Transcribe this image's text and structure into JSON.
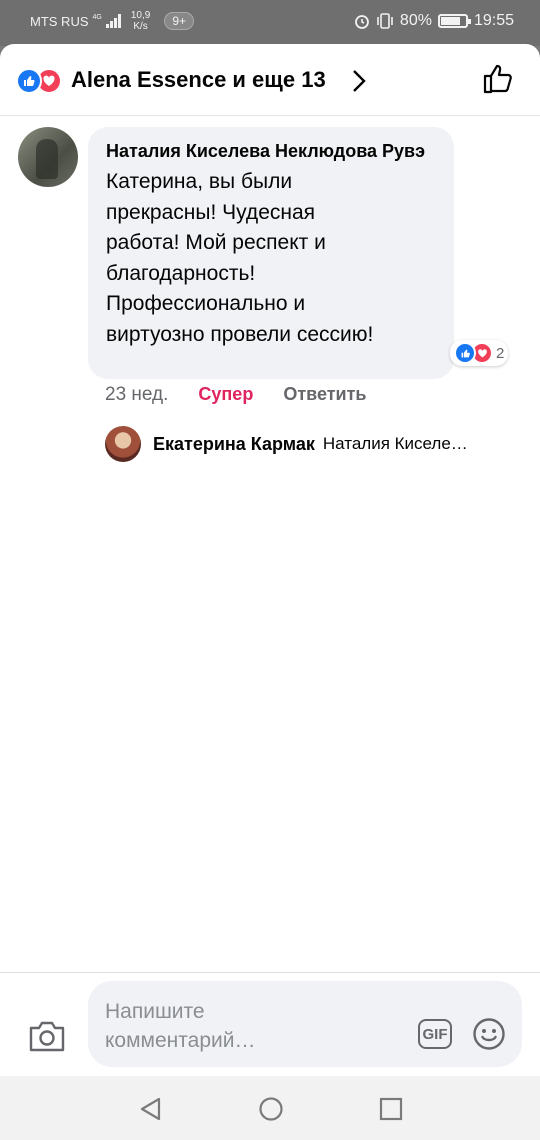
{
  "status_bar": {
    "carrier": "MTS RUS",
    "network": "4G",
    "speed_value": "10,9",
    "speed_unit": "K/s",
    "notifications": "9+",
    "battery_percent": "80%",
    "time": "19:55"
  },
  "header": {
    "title": "Alena Essence и еще 13",
    "reaction_icons": [
      "like-icon",
      "love-icon"
    ]
  },
  "comment": {
    "author": "Наталия Киселева Неклюдова Рувэ",
    "text": "Катерина, вы были\nпрекрасны! Чудесная\nработа! Мой респект и\nблагодарность!\nПрофессионально и\nвиртуозно провели сессию!",
    "reaction_count": "2",
    "time_ago": "23 нед.",
    "reaction_label": "Супер",
    "reply_label": "Ответить"
  },
  "reply": {
    "author": "Екатерина Кармак",
    "preview": "Наталия Киселе…"
  },
  "composer": {
    "placeholder": "Напишите\nкомментарий…",
    "gif_label": "GIF"
  },
  "colors": {
    "like_blue": "#1877f2",
    "love_red": "#f33e58",
    "super_pink": "#e0245e"
  }
}
